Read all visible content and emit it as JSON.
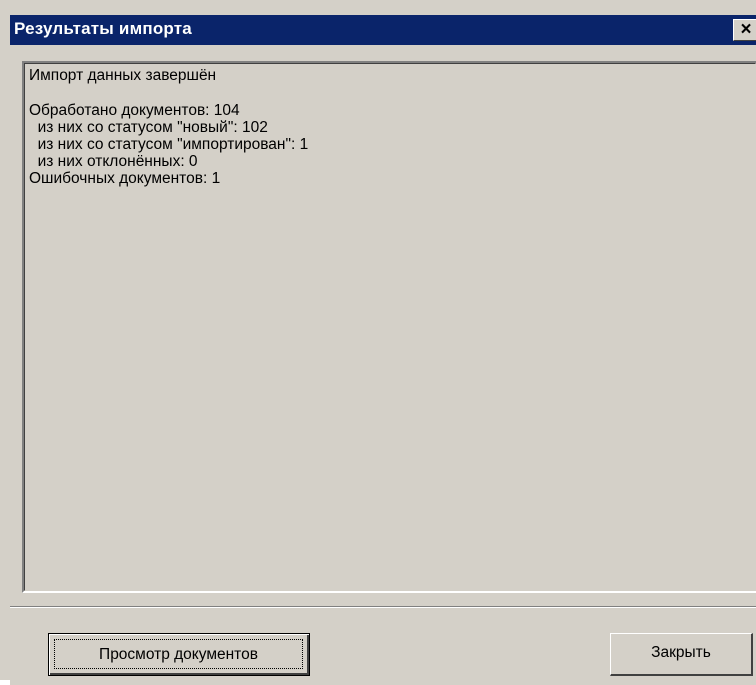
{
  "window": {
    "title": "Результаты импорта",
    "close_glyph": "×"
  },
  "log": {
    "lines": [
      "Импорт данных завершён",
      "",
      "Обработано документов: 104",
      "  из них со статусом \"новый\": 102",
      "  из них со статусом \"импортирован\": 1",
      "  из них отклонённых: 0",
      "Ошибочных документов: 1"
    ]
  },
  "buttons": {
    "view_documents": "Просмотр документов",
    "close": "Закрыть"
  },
  "colors": {
    "titlebar": "#0a246a",
    "face": "#d4d0c8"
  },
  "icons": {
    "close": "close-icon"
  }
}
